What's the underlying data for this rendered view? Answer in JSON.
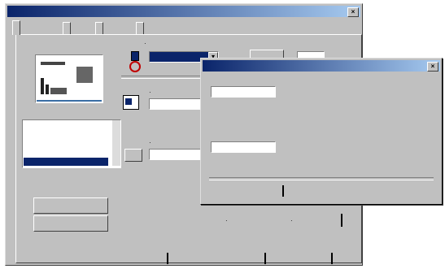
{
  "main_window": {
    "title": "",
    "tabs": [
      "",
      "",
      "",
      ""
    ],
    "group_label": "",
    "dropdown_value": "",
    "list_items": [
      "",
      "",
      "",
      ""
    ],
    "field_value": "",
    "buttons": [
      "",
      "",
      "",
      "",
      ""
    ]
  },
  "dialog": {
    "title": "",
    "field1_label": "",
    "field1_value": "",
    "info_text": "",
    "field2_label": "",
    "field2_value": "",
    "note": "",
    "buttons": [
      "",
      "",
      ""
    ]
  },
  "colors": {
    "titlebar_start": "#0a246a",
    "titlebar_end": "#a6caf0",
    "face": "#c0c0c0"
  }
}
